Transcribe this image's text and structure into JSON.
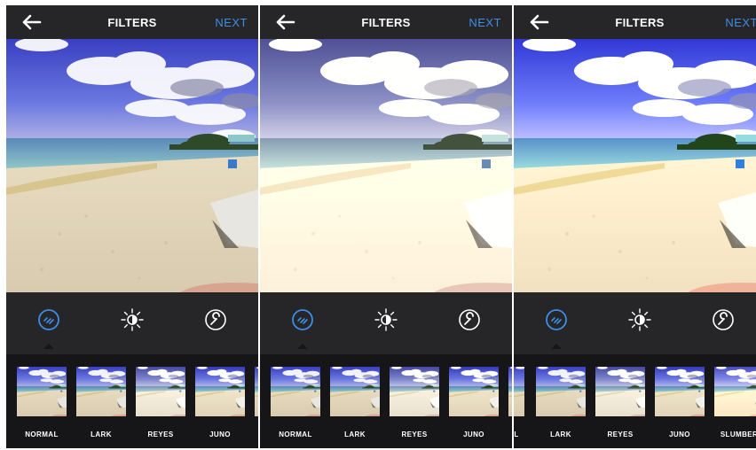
{
  "colors": {
    "accent": "#3d8ee8",
    "background": "#262629",
    "strip": "#161618",
    "text": "#ffffff"
  },
  "panels": [
    {
      "header": {
        "back_icon": "arrow-left-icon",
        "title": "FILTERS",
        "next_label": "NEXT"
      },
      "tools": [
        {
          "name": "filter-icon",
          "active": true
        },
        {
          "name": "brightness-icon",
          "active": false
        },
        {
          "name": "wrench-icon",
          "active": false
        }
      ],
      "filters": [
        "NORMAL",
        "LARK",
        "REYES",
        "JUNO"
      ],
      "selected_filter": "NORMAL"
    },
    {
      "header": {
        "back_icon": "arrow-left-icon",
        "title": "FILTERS",
        "next_label": "NEXT"
      },
      "tools": [
        {
          "name": "filter-icon",
          "active": true
        },
        {
          "name": "brightness-icon",
          "active": false
        },
        {
          "name": "wrench-icon",
          "active": false
        }
      ],
      "filters": [
        "NORMAL",
        "LARK",
        "REYES",
        "JUNO"
      ],
      "selected_filter": "REYES"
    },
    {
      "header": {
        "back_icon": "arrow-left-icon",
        "title": "FILTERS",
        "next_label": "NEXT"
      },
      "tools": [
        {
          "name": "filter-icon",
          "active": true
        },
        {
          "name": "brightness-icon",
          "active": false
        },
        {
          "name": "wrench-icon",
          "active": false
        }
      ],
      "filters": [
        "L",
        "LARK",
        "REYES",
        "JUNO",
        "SLUMBER"
      ],
      "selected_filter": "LARK"
    }
  ]
}
